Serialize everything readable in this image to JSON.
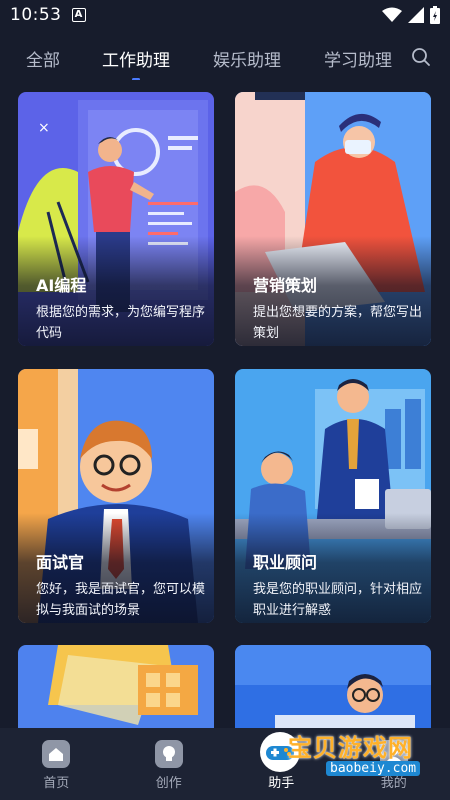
{
  "status": {
    "time": "10:53",
    "notification_glyph": "A"
  },
  "tabs": [
    {
      "label": "全部",
      "active": false
    },
    {
      "label": "工作助理",
      "active": true
    },
    {
      "label": "娱乐助理",
      "active": false
    },
    {
      "label": "学习助理",
      "active": false
    }
  ],
  "cards": [
    {
      "title": "AI编程",
      "desc": "根据您的需求，为您编写程序代码"
    },
    {
      "title": "营销策划",
      "desc": "提出您想要的方案，帮您写出策划"
    },
    {
      "title": "面试官",
      "desc": "您好，我是面试官，您可以模拟与我面试的场景"
    },
    {
      "title": "职业顾问",
      "desc": "我是您的职业顾问，针对相应职业进行解惑"
    }
  ],
  "bottom_nav": [
    {
      "label": "首页",
      "icon": "home-icon",
      "active": false
    },
    {
      "label": "创作",
      "icon": "bulb-icon",
      "active": false
    },
    {
      "label": "助手",
      "icon": "assistant-icon",
      "active": true
    },
    {
      "label": "我的",
      "icon": "profile-icon",
      "active": false
    }
  ],
  "watermark": {
    "text": "宝贝游戏网",
    "url": "baobeiy.com"
  },
  "colors": {
    "background": "#171c2c",
    "accent": "#4b7bff",
    "nav_bg": "#1d2334"
  }
}
